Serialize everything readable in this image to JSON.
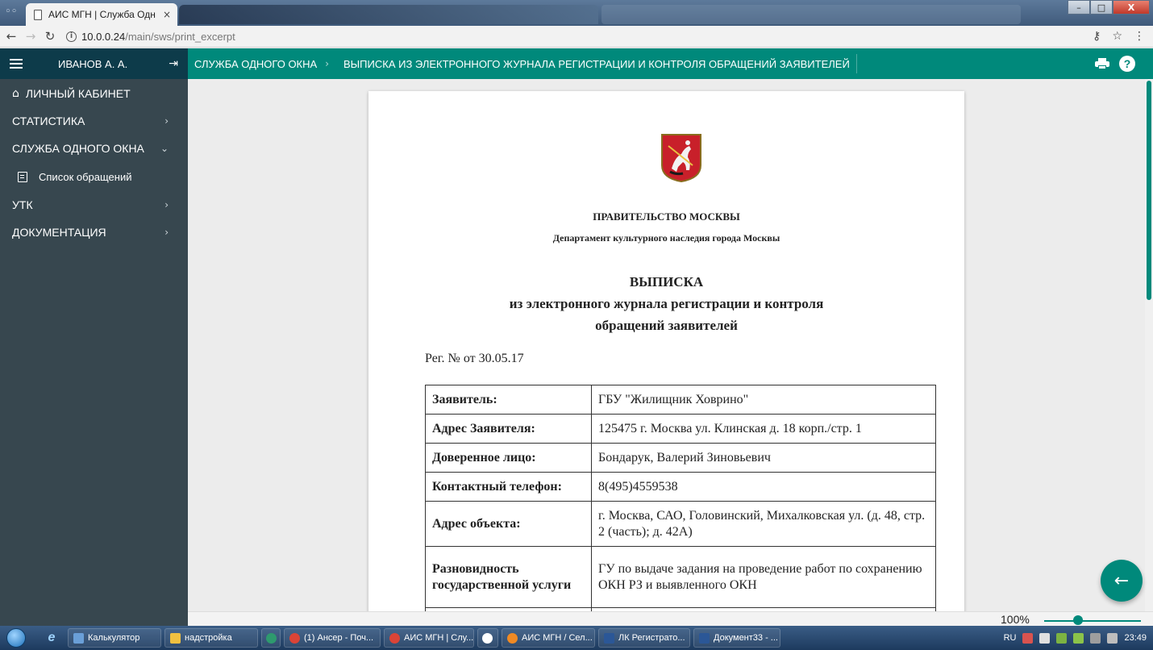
{
  "browser": {
    "tab_title": "АИС МГН | Служба Одн",
    "tab_close": "×",
    "url_host": "10.0.0.24",
    "url_path": "/main/sws/print_excerpt",
    "window_buttons": {
      "minimize": "–",
      "maximize": "□",
      "close": "X"
    }
  },
  "header": {
    "user_name": "ИВАНОВ А. А.",
    "breadcrumb": [
      "СЛУЖБА ОДНОГО ОКНА",
      "ВЫПИСКА ИЗ ЭЛЕКТРОННОГО ЖУРНАЛА РЕГИСТРАЦИИ И КОНТРОЛЯ ОБРАЩЕНИЙ ЗАЯВИТЕЛЕЙ"
    ],
    "help_symbol": "?"
  },
  "sidebar": {
    "items": [
      {
        "label": "ЛИЧНЫЙ КАБИНЕТ"
      },
      {
        "label": "СТАТИСТИКА"
      },
      {
        "label": "СЛУЖБА ОДНОГО ОКНА"
      },
      {
        "label": "Список обращений"
      },
      {
        "label": "УТК"
      },
      {
        "label": "ДОКУМЕНТАЦИЯ"
      }
    ]
  },
  "document": {
    "org": "ПРАВИТЕЛЬСТВО МОСКВЫ",
    "department": "Департамент культурного наследия города Москвы",
    "title": "ВЫПИСКА",
    "subtitle_1": "из электронного журнала регистрации и контроля",
    "subtitle_2": "обращений заявителей",
    "reg_line": "Рег. № от 30.05.17",
    "rows": [
      {
        "key": "Заявитель:",
        "value": "ГБУ \"Жилищник Ховрино\""
      },
      {
        "key": "Адрес Заявителя:",
        "value": "125475 г. Москва ул. Клинская д. 18 корп./стр. 1"
      },
      {
        "key": "Доверенное лицо:",
        "value": "Бондарук, Валерий Зиновьевич"
      },
      {
        "key": "Контактный телефон:",
        "value": "8(495)4559538"
      },
      {
        "key": "Адрес объекта:",
        "value": "г. Москва, САО, Головинский, Михалковская ул. (д. 48, стр. 2 (часть); д. 42А)"
      },
      {
        "key": "Разновидность государственной услуги",
        "value": "ГУ по выдаче задания на проведение работ по сохранению ОКН РЗ и выявленного ОКН"
      }
    ]
  },
  "zoom": {
    "label": "100%",
    "level": 0.35
  },
  "taskbar": {
    "items": [
      {
        "label": "Калькулятор",
        "color": "#6a9fd8"
      },
      {
        "label": "надстройка",
        "color": "#f0c040"
      },
      {
        "label": "(1) Ансер - Поч...",
        "color": "#db4437"
      },
      {
        "label": "АИС МГН | Слу...",
        "color": "#db4437"
      },
      {
        "label": "АИС МГН / Сел...",
        "color": "#f08a24"
      },
      {
        "label": "ЛК Регистрато...",
        "color": "#2b5797"
      },
      {
        "label": "Документ33 - ...",
        "color": "#2b5797"
      }
    ],
    "language": "RU",
    "clock": "23:49"
  },
  "colors": {
    "teal": "#00897b",
    "sidebar": "#37474f",
    "sidebar_header": "#0d3b4a"
  }
}
